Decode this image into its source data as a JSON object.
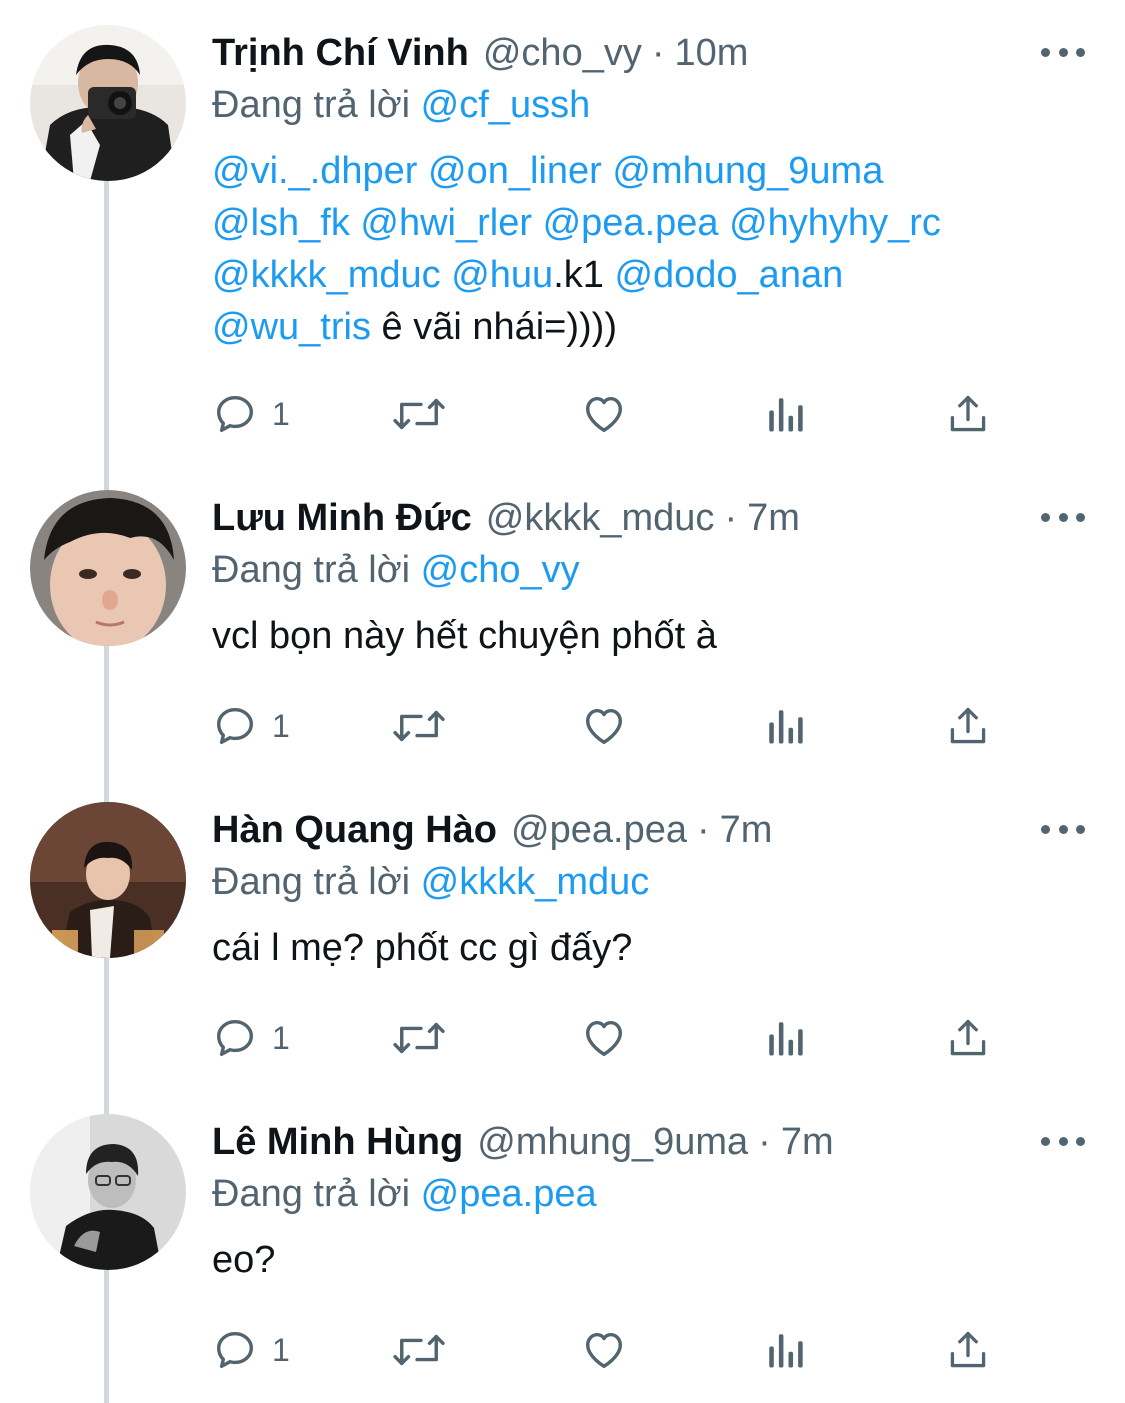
{
  "tweets": [
    {
      "name": "Trịnh Chí Vinh",
      "handle": "@cho_vy",
      "time": "10m",
      "reply_prefix": "Đang trả lời",
      "reply_to": "@cf_ussh",
      "body_lines": [
        [
          {
            "t": "@vi._.dhper",
            "m": true
          },
          {
            "t": " ",
            "m": false
          },
          {
            "t": "@on_liner",
            "m": true
          },
          {
            "t": " ",
            "m": false
          },
          {
            "t": "@mhung_9uma",
            "m": true
          }
        ],
        [
          {
            "t": "@lsh_fk",
            "m": true
          },
          {
            "t": " ",
            "m": false
          },
          {
            "t": "@hwi_rler",
            "m": true
          },
          {
            "t": " ",
            "m": false
          },
          {
            "t": "@pea.pea",
            "m": true
          },
          {
            "t": " ",
            "m": false
          },
          {
            "t": "@hyhyhy_rc",
            "m": true
          }
        ],
        [
          {
            "t": "@kkkk_mduc",
            "m": true
          },
          {
            "t": " ",
            "m": false
          },
          {
            "t": "@huu",
            "m": true
          },
          {
            "t": ".k1 ",
            "m": false
          },
          {
            "t": "@dodo_anan",
            "m": true
          }
        ],
        [
          {
            "t": "@wu_tris",
            "m": true
          },
          {
            "t": " ê vãi nhái=))))",
            "m": false
          }
        ]
      ],
      "reply_count": "1"
    },
    {
      "name": "Lưu Minh Đức",
      "handle": "@kkkk_mduc",
      "time": "7m",
      "reply_prefix": "Đang trả lời",
      "reply_to": "@cho_vy",
      "body_lines": [
        [
          {
            "t": "vcl bọn này hết chuyện phốt à",
            "m": false
          }
        ]
      ],
      "reply_count": "1"
    },
    {
      "name": "Hàn Quang Hào",
      "handle": "@pea.pea",
      "time": "7m",
      "reply_prefix": "Đang trả lời",
      "reply_to": "@kkkk_mduc",
      "body_lines": [
        [
          {
            "t": "cái l mẹ? phốt cc gì đấy?",
            "m": false
          }
        ]
      ],
      "reply_count": "1"
    },
    {
      "name": "Lê Minh Hùng",
      "handle": "@mhung_9uma",
      "time": "7m",
      "reply_prefix": "Đang trả lời",
      "reply_to": "@pea.pea",
      "body_lines": [
        [
          {
            "t": "eo?",
            "m": false
          }
        ]
      ],
      "reply_count": "1"
    }
  ],
  "separator": "·",
  "icons": [
    "reply-icon",
    "retweet-icon",
    "like-icon",
    "analytics-icon",
    "share-icon",
    "more-icon"
  ],
  "colors": {
    "mention": "#1d9bf0",
    "secondary_text": "#536471",
    "thread_line": "#cfd9de"
  }
}
